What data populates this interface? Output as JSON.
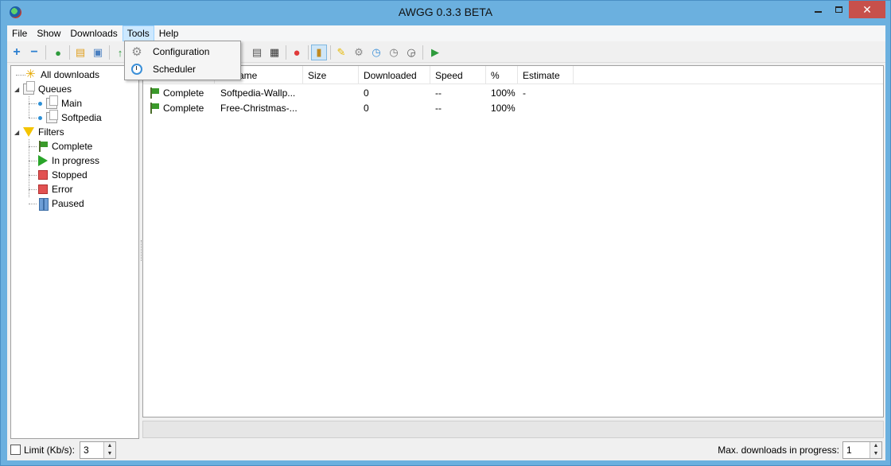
{
  "window": {
    "title": "AWGG 0.3.3 BETA"
  },
  "menu": [
    "File",
    "Show",
    "Downloads",
    "Tools",
    "Help"
  ],
  "tools_menu": {
    "items": [
      "Configuration",
      "Scheduler"
    ]
  },
  "tree": {
    "all": "All downloads",
    "queues": "Queues",
    "queue_items": [
      "Main",
      "Softpedia"
    ],
    "filters": "Filters",
    "filter_items": [
      "Complete",
      "In progress",
      "Stopped",
      "Error",
      "Paused"
    ]
  },
  "list": {
    "columns": [
      "Name",
      "Size",
      "Downloaded",
      "Speed",
      "%",
      "Estimate"
    ],
    "name_partial": "ame",
    "rows": [
      {
        "status": "Complete",
        "name": "Softpedia-Wallp...",
        "size": "",
        "downloaded": "0",
        "speed": "--",
        "percent": "100%",
        "estimate": "-"
      },
      {
        "status": "Complete",
        "name": "Free-Christmas-...",
        "size": "",
        "downloaded": "0",
        "speed": "--",
        "percent": "100%",
        "estimate": ""
      }
    ]
  },
  "bottom": {
    "limit_label": "Limit (Kb/s):",
    "limit_value": "3",
    "max_label": "Max. downloads in progress:",
    "max_value": "1"
  },
  "colors": {
    "title_bar": "#6bb0df",
    "close_button": "#c7504b",
    "menu_open": "#cce8ff"
  }
}
